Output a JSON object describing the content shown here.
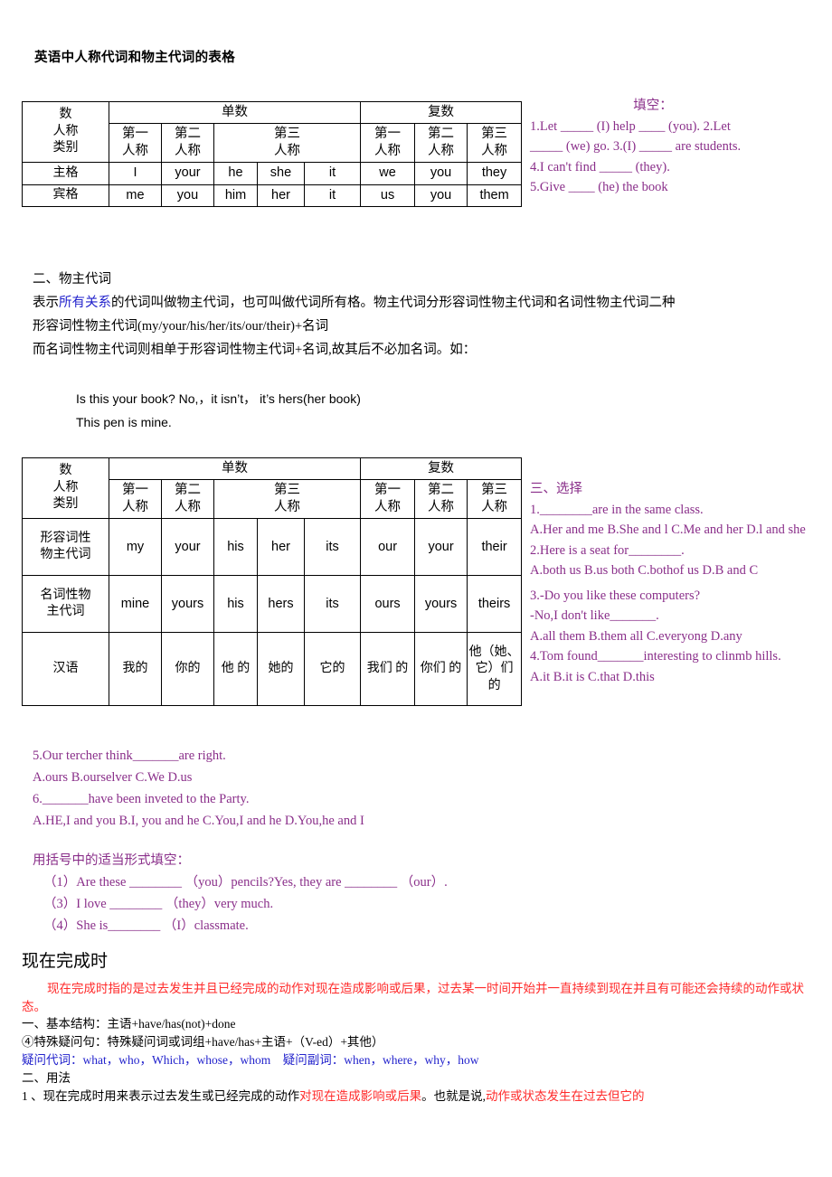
{
  "document": {
    "title": "英语中人称代词和物主代词的表格"
  },
  "table1": {
    "name": "personal-pronouns-table",
    "corner": [
      "数",
      "人称",
      "类别"
    ],
    "number_headers": [
      "单数",
      "复数"
    ],
    "person_headers": [
      "第一\n人称",
      "第二\n人称",
      "第三\n人称",
      "第一\n人称",
      "第二\n人称",
      "第三\n人称"
    ],
    "person_headers_flat": {
      "s1": "第一 人称",
      "s2": "第二 人称",
      "s3": "第三 人称",
      "p1": "第一 人称",
      "p2": "第二 人称",
      "p3": "第三 人称"
    },
    "rows": [
      {
        "label": "主格",
        "cells": [
          "I",
          "your",
          "he",
          "she",
          "it",
          "we",
          "you",
          "they"
        ]
      },
      {
        "label": "宾格",
        "cells": [
          "me",
          "you",
          "him",
          "her",
          "it",
          "us",
          "you",
          "them"
        ]
      }
    ]
  },
  "section2": {
    "heading": "二、物主代词",
    "line1_a": "表示",
    "line1_blue": "所有关系",
    "line1_b": "的代词叫做物主代词，也可叫做代词所有格。物主代词分形容词性物主代词和名词性物主代词二种",
    "line2": "形容词性物主代词(my/your/his/her/its/our/their)+名词",
    "line3": "而名词性物主代词则相单于形容词性物主代词+名词,故其后不必加名词。如：",
    "example1": "Is this your book?     No,，it isn’t，  it’s hers(her book)",
    "example2": "This pen is mine."
  },
  "table2": {
    "name": "possessive-pronouns-table",
    "corner": [
      "数",
      "人称",
      "类别"
    ],
    "number_headers": [
      "单数",
      "复数"
    ],
    "person_headers_flat": {
      "s1": "第一 人称",
      "s2": "第二 人称",
      "s3": "第三 人称",
      "p1": "第一 人称",
      "p2": "第二 人称",
      "p3": "第三 人称"
    },
    "rows": [
      {
        "label": "形容词性 物主代词",
        "cells": [
          "my",
          "your",
          "his",
          "her",
          "its",
          "our",
          "your",
          "their"
        ]
      },
      {
        "label": "名词性物 主代词",
        "cells": [
          "mine",
          "yours",
          "his",
          "hers",
          "its",
          "ours",
          "yours",
          "theirs"
        ]
      },
      {
        "label": "汉语",
        "cells": [
          "我的",
          "你的",
          "他 的",
          "她的",
          "它的",
          "我们 的",
          "你们 的",
          "他（她、它）们 的"
        ]
      }
    ]
  },
  "fill_in": {
    "heading": "填空：",
    "lines": [
      "1.Let _____ (I)  help ____ (you).    2.Let",
      "_____ (we) go.    3.(I) _____ are students.",
      "4.I can't find _____ (they).",
      "5.Give ____ (he) the book"
    ]
  },
  "multiple_choice": {
    "heading": "三、选择",
    "items": [
      {
        "question": "1.________are in the same class.",
        "options": "A.Her and me B.She and l C.Me and her D.l and she"
      },
      {
        "question": "2.Here is a seat for________.",
        "options": "A.both us B.us both C.bothof us D.B and C"
      },
      {
        "question": "3.-Do you like these computers?",
        "question2": "-No,I don't like_______.",
        "options": "A.all them B.them all C.everyong D.any"
      },
      {
        "question": "4.Tom found_______interesting to clinmb hills.",
        "options": "A.it B.it is C.that D.this"
      }
    ]
  },
  "more_choice": {
    "lines": [
      "5.Our tercher think_______are right.",
      "A.ours B.ourselver C.We D.us",
      "6._______have been inveted to the Party.",
      "A.HE,I and you B.I, you and he C.You,I and he D.You,he and I"
    ]
  },
  "bracket_exercise": {
    "heading": "用括号中的适当形式填空：",
    "items": [
      "（1）Are these ________ （you）pencils?Yes, they are ________ （our）.",
      "（3）I love ________ （they）very much.",
      "（4）She is________ （I）classmate."
    ]
  },
  "present_perfect": {
    "title": "现在完成时",
    "intro_red": "现在完成时指的是过去发生并且已经完成的动作对现在造成影响或后果，过去某一时间开始并一直持续到现在并且有可能还会持续的动作或状态。",
    "structure_heading": "一、基本结构：主语+have/has(not)+done",
    "special_question": "④特殊疑问句：特殊疑问词或词组+have/has+主语+（V-ed）+其他）",
    "interrogative_pronouns_label": "疑问代词：",
    "interrogative_pronouns": "what，who，Which，whose，whom",
    "interrogative_adverbs_label": "疑问副词：",
    "interrogative_adverbs": "when，where，why，how",
    "usage_heading": "二、用法",
    "usage1_a": "1 、现在完成时用来表示过去发生或已经完成的动作",
    "usage1_red1": "对现在造成影响或后果",
    "usage1_b": "。也就是说,",
    "usage1_red2": "动作或状态发生在过去但它的"
  },
  "colors": {
    "purple": "#8a2f8a",
    "red": "#ff2a2a",
    "blue": "#2222cc",
    "black": "#000000"
  }
}
